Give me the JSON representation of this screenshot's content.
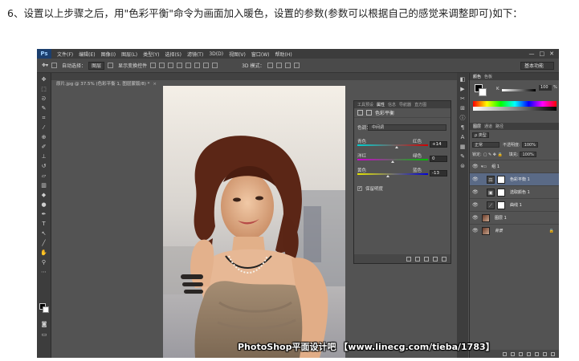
{
  "caption": "6、设置以上步骤之后，用\"色彩平衡\"命令为画面加入暖色，设置的参数(参数可以根据自己的感觉来调整即可)如下：",
  "ps": {
    "logo": "Ps",
    "menu": [
      "文件(F)",
      "编辑(E)",
      "图像(I)",
      "图层(L)",
      "类型(Y)",
      "选择(S)",
      "滤镜(T)",
      "3D(D)",
      "视图(V)",
      "窗口(W)",
      "帮助(H)"
    ],
    "window_controls": [
      "—",
      "□",
      "✕"
    ],
    "options": {
      "auto_select_label": "自动选择：",
      "auto_select_value": "图层",
      "show_transform": "显示变换控件",
      "mode_3d": "3D 模式：",
      "workspace": "基本功能"
    },
    "doc_tab": {
      "title": "原片.jpg @ 37.5% (色彩平衡 1, 图层蒙版/8) *",
      "close": "×"
    },
    "properties": {
      "tabs": [
        "工具预设",
        "属性",
        "信息",
        "导航器",
        "直方图"
      ],
      "active_tab": 1,
      "title": "色彩平衡",
      "tone_label": "色调：",
      "tone_value": "中间调",
      "sliders": [
        {
          "left": "青色",
          "right": "红色",
          "value": "+14"
        },
        {
          "left": "洋红",
          "right": "绿色",
          "value": "0"
        },
        {
          "left": "黄色",
          "right": "蓝色",
          "value": "-13"
        }
      ],
      "preserve_luminosity": "保留明度"
    },
    "color_panel": {
      "tabs": [
        "颜色",
        "色板"
      ],
      "k_label": "K",
      "k_value": "100",
      "k_unit": "%"
    },
    "layers_panel": {
      "tabs": [
        "图层",
        "通道",
        "路径"
      ],
      "filter_label": "ρ 类型",
      "blend_mode": "正常",
      "opacity_label": "不透明度:",
      "opacity_value": "100%",
      "lock_label": "锁定:",
      "fill_label": "填充:",
      "fill_value": "100%",
      "layers": [
        {
          "name": "组 1",
          "type": "group"
        },
        {
          "name": "色彩平衡 1",
          "type": "adjustment",
          "selected": true
        },
        {
          "name": "选取颜色 1",
          "type": "adjustment"
        },
        {
          "name": "曲线 1",
          "type": "adjustment"
        },
        {
          "name": "图层 1",
          "type": "photo"
        },
        {
          "name": "背景",
          "type": "photo",
          "locked": true
        }
      ]
    }
  },
  "watermark": "PhotoShop平面设计吧 【www.linecg.com/tieba/1783】"
}
